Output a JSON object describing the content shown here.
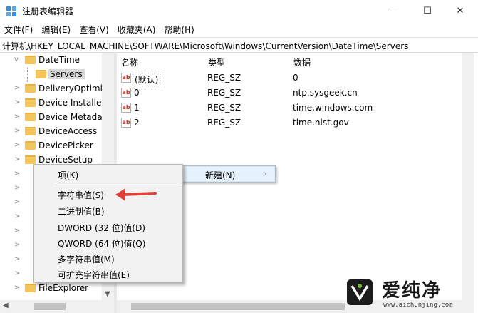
{
  "window": {
    "title": "注册表编辑器",
    "min_glyph": "—",
    "max_glyph": "☐",
    "close_glyph": "✕",
    "app_icon": "registry-icon"
  },
  "menu": [
    "文件(F)",
    "编辑(E)",
    "查看(V)",
    "收藏夹(A)",
    "帮助(H)"
  ],
  "address": "计算机\\HKEY_LOCAL_MACHINE\\SOFTWARE\\Microsoft\\Windows\\CurrentVersion\\DateTime\\Servers",
  "tree": {
    "items": [
      {
        "label": "DateTime",
        "expanded": true
      },
      {
        "label": "Servers",
        "selected": true
      },
      {
        "label": "DeliveryOptimiz"
      },
      {
        "label": "Device Installer"
      },
      {
        "label": "Device Metada"
      },
      {
        "label": "DeviceAccess"
      },
      {
        "label": "DevicePicker"
      },
      {
        "label": "DeviceSetup"
      },
      {
        "label": "FileExplorer"
      }
    ],
    "expanded_glyph": "v",
    "collapsed_glyph": ">"
  },
  "values": {
    "headers": {
      "name": "名称",
      "type": "类型",
      "data": "数据"
    },
    "icon": "ab",
    "rows": [
      {
        "name": "(默认)",
        "type": "REG_SZ",
        "data": "0"
      },
      {
        "name": "0",
        "type": "REG_SZ",
        "data": "ntp.sysgeek.cn"
      },
      {
        "name": "1",
        "type": "REG_SZ",
        "data": "time.windows.com"
      },
      {
        "name": "2",
        "type": "REG_SZ",
        "data": "time.nist.gov"
      }
    ]
  },
  "context_menu": {
    "label": "新建(N)",
    "arrow": "›"
  },
  "submenu": {
    "key": "项(K)",
    "items": [
      "字符串值(S)",
      "二进制值(B)",
      "DWORD (32 位)值(D)",
      "QWORD (64 位)值(Q)",
      "多字符串值(M)",
      "可扩充字符串值(E)"
    ]
  },
  "annotation": {
    "arrow_color": "#e0413a"
  },
  "watermark": {
    "brand": "爱纯净",
    "url": "www.aichunjing.com"
  },
  "colors": {
    "folder": "#f4c55b",
    "highlight": "#e5f1fb",
    "menu_bg": "#f2f2f2"
  }
}
